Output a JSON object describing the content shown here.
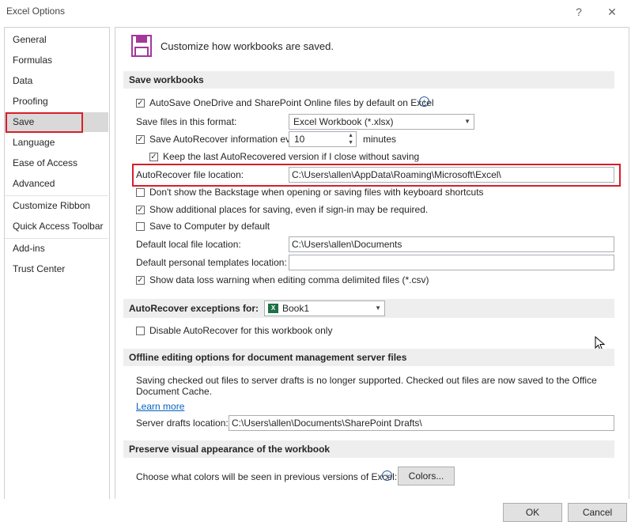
{
  "window": {
    "title": "Excel Options",
    "help": "?",
    "close": "✕"
  },
  "sidebar": {
    "items": [
      {
        "label": "General"
      },
      {
        "label": "Formulas"
      },
      {
        "label": "Data"
      },
      {
        "label": "Proofing"
      },
      {
        "label": "Save"
      },
      {
        "label": "Language"
      },
      {
        "label": "Ease of Access"
      },
      {
        "label": "Advanced"
      },
      {
        "label": "Customize Ribbon"
      },
      {
        "label": "Quick Access Toolbar"
      },
      {
        "label": "Add-ins"
      },
      {
        "label": "Trust Center"
      }
    ]
  },
  "main": {
    "header": "Customize how workbooks are saved.",
    "save_workbooks": {
      "heading": "Save workbooks",
      "autosave_label": "AutoSave OneDrive and SharePoint Online files by default on Excel",
      "autosave_checked": true,
      "format_label": "Save files in this format:",
      "format_value": "Excel Workbook (*.xlsx)",
      "autorecover_label": "Save AutoRecover information every",
      "autorecover_checked": true,
      "autorecover_minutes": "10",
      "minutes_label": "minutes",
      "keep_last_label": "Keep the last AutoRecovered version if I close without saving",
      "keep_last_checked": true,
      "ar_location_label": "AutoRecover file location:",
      "ar_location_value": "C:\\Users\\allen\\AppData\\Roaming\\Microsoft\\Excel\\",
      "backstage_label": "Don't show the Backstage when opening or saving files with keyboard shortcuts",
      "backstage_checked": false,
      "additional_places_label": "Show additional places for saving, even if sign-in may be required.",
      "additional_places_checked": true,
      "save_computer_label": "Save to Computer by default",
      "save_computer_checked": false,
      "default_local_label": "Default local file location:",
      "default_local_value": "C:\\Users\\allen\\Documents",
      "personal_templates_label": "Default personal templates location:",
      "personal_templates_value": "",
      "data_loss_label": "Show data loss warning when editing comma delimited files (*.csv)",
      "data_loss_checked": true
    },
    "exceptions": {
      "heading": "AutoRecover exceptions for:",
      "workbook": "Book1",
      "disable_label": "Disable AutoRecover for this workbook only",
      "disable_checked": false
    },
    "offline": {
      "heading": "Offline editing options for document management server files",
      "text1": "Saving checked out files to server drafts is no longer supported. Checked out files are now saved to the Office",
      "text2": "Document Cache.",
      "learn_more": "Learn more",
      "drafts_label": "Server drafts location:",
      "drafts_value": "C:\\Users\\allen\\Documents\\SharePoint Drafts\\"
    },
    "preserve": {
      "heading": "Preserve visual appearance of the workbook",
      "colors_label": "Choose what colors will be seen in previous versions of Excel:",
      "colors_button": "Colors..."
    }
  },
  "footer": {
    "ok": "OK",
    "cancel": "Cancel"
  },
  "colors": {
    "highlight": "#d81e2a",
    "save_icon": "#a4379b",
    "excel_icon": "#1e7145"
  }
}
